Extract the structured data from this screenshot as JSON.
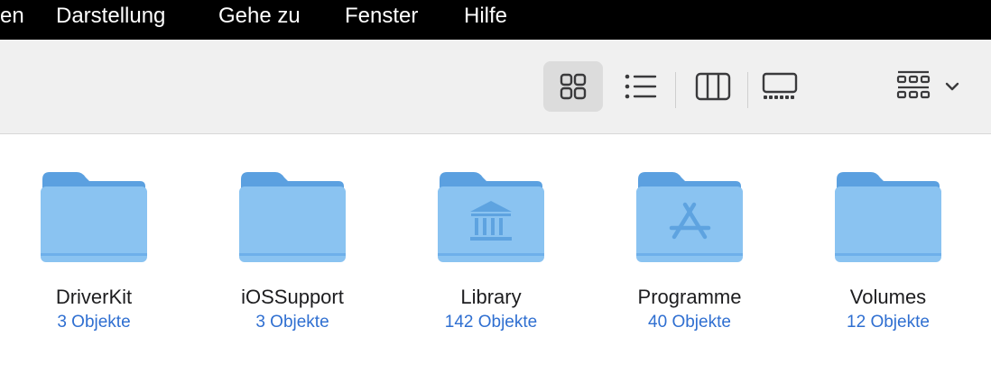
{
  "menubar": {
    "items": [
      {
        "label": "en"
      },
      {
        "label": "Darstellung"
      },
      {
        "label": "Gehe zu"
      },
      {
        "label": "Fenster"
      },
      {
        "label": "Hilfe"
      }
    ]
  },
  "toolbar": {
    "views": [
      {
        "icon": "icon-view-icon",
        "active": true
      },
      {
        "icon": "list-view-icon",
        "active": false
      },
      {
        "icon": "column-view-icon",
        "active": false
      },
      {
        "icon": "gallery-view-icon",
        "active": false
      }
    ],
    "group": {
      "icon": "group-icon",
      "chevron": "chevron-down-icon"
    }
  },
  "folders": [
    {
      "name": "DriverKit",
      "count": "3 Objekte",
      "glyph": "none"
    },
    {
      "name": "iOSSupport",
      "count": "3 Objekte",
      "glyph": "none"
    },
    {
      "name": "Library",
      "count": "142 Objekte",
      "glyph": "library-icon"
    },
    {
      "name": "Programme",
      "count": "40 Objekte",
      "glyph": "app-store-icon"
    },
    {
      "name": "Volumes",
      "count": "12 Objekte",
      "glyph": "none"
    }
  ],
  "colors": {
    "folder_body": "#8ac3f1",
    "folder_back": "#5ba0e0",
    "count_text": "#2f6fd1"
  }
}
